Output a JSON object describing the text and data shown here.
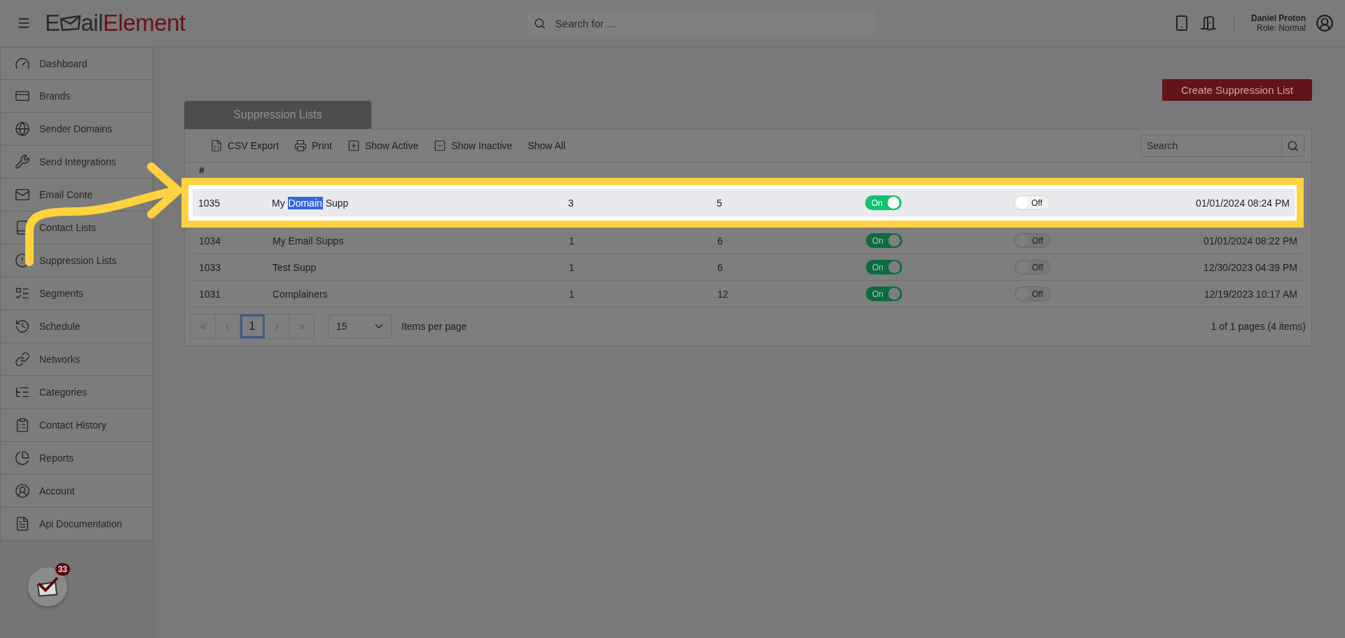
{
  "header": {
    "logo": {
      "part_1": "E",
      "part_2": "ail",
      "part_3": "Element"
    },
    "search": {
      "placeholder": "Search for ..."
    },
    "user": {
      "name": "Daniel Proton",
      "role": "Role: Normal"
    }
  },
  "sidebar": {
    "items": [
      {
        "label": "Dashboard",
        "kind": "gauge"
      },
      {
        "label": "Brands",
        "kind": "card"
      },
      {
        "label": "Sender Domains",
        "kind": "globe"
      },
      {
        "label": "Send Integrations",
        "kind": "wrench"
      },
      {
        "label": "Email Conte",
        "kind": "mail"
      },
      {
        "label": "Contact Lists",
        "kind": "book"
      },
      {
        "label": "Suppression Lists",
        "kind": "alert"
      },
      {
        "label": "Segments",
        "kind": "segments"
      },
      {
        "label": "Schedule",
        "kind": "clock"
      },
      {
        "label": "Networks",
        "kind": "link"
      },
      {
        "label": "Categories",
        "kind": "categories"
      },
      {
        "label": "Contact History",
        "kind": "clipboard"
      },
      {
        "label": "Reports",
        "kind": "pie"
      },
      {
        "label": "Account",
        "kind": "user"
      },
      {
        "label": "Api Documentation",
        "kind": "doc"
      }
    ],
    "notification_count": "33"
  },
  "create_button": "Create Suppression List",
  "tab": "Suppression Lists",
  "toolbar": [
    {
      "label": "CSV Export",
      "kind": "csv"
    },
    {
      "label": "Print",
      "kind": "print"
    },
    {
      "label": "Show Active",
      "kind": "plus"
    },
    {
      "label": "Show Inactive",
      "kind": "minus"
    },
    {
      "label": "Show All",
      "kind": "none"
    }
  ],
  "table_search": {
    "placeholder": "Search"
  },
  "table": {
    "columns": [
      "#"
    ],
    "rows": [
      {
        "id": "1035",
        "name_segments": [
          {
            "text": "My",
            "selected": false
          },
          {
            "text": "Domain",
            "selected": true
          },
          {
            "text": "Supp",
            "selected": false
          }
        ],
        "export": "3",
        "bounced": "5",
        "active": {
          "label": "On",
          "on": true
        },
        "global": {
          "label": "Off",
          "on": false
        },
        "created": "01/01/2024 08:24 PM",
        "highlighted": true
      },
      {
        "id": "1034",
        "name_segments": [
          {
            "text": "My Email Supps",
            "selected": false
          }
        ],
        "export": "1",
        "bounced": "6",
        "active": {
          "label": "On",
          "on": true
        },
        "global": {
          "label": "Off",
          "on": false
        },
        "created": "01/01/2024 08:22 PM",
        "highlighted": false
      },
      {
        "id": "1033",
        "name_segments": [
          {
            "text": "Test Supp",
            "selected": false
          }
        ],
        "export": "1",
        "bounced": "6",
        "active": {
          "label": "On",
          "on": true
        },
        "global": {
          "label": "Off",
          "on": false
        },
        "created": "12/30/2023 04:39 PM",
        "highlighted": false
      },
      {
        "id": "1031",
        "name_segments": [
          {
            "text": "Complainers",
            "selected": false
          }
        ],
        "export": "1",
        "bounced": "12",
        "active": {
          "label": "On",
          "on": true
        },
        "global": {
          "label": "Off",
          "on": false
        },
        "created": "12/19/2023 10:17 AM",
        "highlighted": false
      }
    ]
  },
  "pagination": {
    "pages": [
      {
        "label": "«",
        "kind": "first"
      },
      {
        "label": "‹",
        "kind": "prev"
      },
      {
        "label": "1",
        "kind": "page",
        "selected": true
      },
      {
        "label": "›",
        "kind": "next"
      },
      {
        "label": "»",
        "kind": "last"
      }
    ],
    "page_size": "15",
    "page_size_label": "Items per page",
    "summary": "1 of 1 pages (4 items)"
  }
}
